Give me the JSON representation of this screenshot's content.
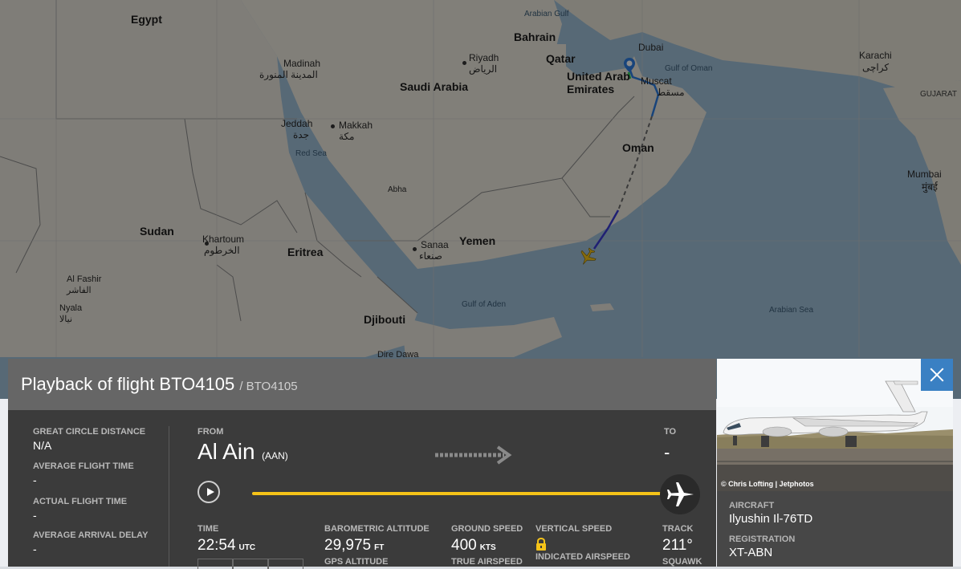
{
  "map": {
    "countries": {
      "egypt": "Egypt",
      "saudi_arabia": "Saudi Arabia",
      "bahrain": "Bahrain",
      "qatar": "Qatar",
      "uae": "United Arab Emirates",
      "oman": "Oman",
      "yemen": "Yemen",
      "sudan": "Sudan",
      "eritrea": "Eritrea",
      "djibouti": "Djibouti"
    },
    "cities": {
      "madinah": "Madinah",
      "madinah_ar": "المدينة المنورة",
      "riyadh": "Riyadh",
      "riyadh_ar": "الرياض",
      "jeddah": "Jeddah",
      "jeddah_ar": "جدة",
      "makkah": "Makkah",
      "makkah_ar": "مكة",
      "dubai": "Dubai",
      "muscat": "Muscat",
      "muscat_ar": "مسقط",
      "karachi": "Karachi",
      "karachi_ar": "کراچی",
      "gujarat": "GUJARAT",
      "mumbai": "Mumbai",
      "mumbai_hi": "मुंबई",
      "abha": "Abha",
      "sanaa": "Sanaa",
      "sanaa_ar": "صنعاء",
      "khartoum": "Khartoum",
      "khartoum_ar": "الخرطوم",
      "al_fashir": "Al Fashir",
      "al_fashir_ar": "الفاشر",
      "nyala": "Nyala",
      "nyala_ar": "نيالا",
      "dire_dawa": "Dire Dawa"
    },
    "seas": {
      "arabian_gulf": "Arabian Gulf",
      "gulf_of_oman": "Gulf of Oman",
      "red_sea": "Red Sea",
      "gulf_of_aden": "Gulf of Aden",
      "arabian_sea": "Arabian Sea"
    }
  },
  "playback": {
    "title": "Playback of flight BTO4105",
    "subtitle": "/ BTO4105",
    "progress": 1.0
  },
  "stats": {
    "great_circle_distance_label": "GREAT CIRCLE DISTANCE",
    "great_circle_distance_value": "N/A",
    "avg_flight_time_label": "AVERAGE FLIGHT TIME",
    "avg_flight_time_value": "-",
    "actual_flight_time_label": "ACTUAL FLIGHT TIME",
    "actual_flight_time_value": "-",
    "avg_arrival_delay_label": "AVERAGE ARRIVAL DELAY",
    "avg_arrival_delay_value": "-"
  },
  "route": {
    "from_label": "FROM",
    "from_city": "Al Ain",
    "from_code": "(AAN)",
    "to_label": "TO",
    "to_city": "-"
  },
  "telemetry": {
    "time_label": "TIME",
    "time_value": "22:54",
    "time_unit": "UTC",
    "baro_alt_label": "BAROMETRIC ALTITUDE",
    "baro_alt_value": "29,975",
    "baro_alt_unit": "FT",
    "gps_alt_label": "GPS ALTITUDE",
    "ground_speed_label": "GROUND SPEED",
    "ground_speed_value": "400",
    "ground_speed_unit": "KTS",
    "true_airspeed_label": "TRUE AIRSPEED",
    "vertical_speed_label": "VERTICAL SPEED",
    "indicated_airspeed_label": "INDICATED AIRSPEED",
    "track_label": "TRACK",
    "track_value": "211°",
    "squawk_label": "SQUAWK"
  },
  "aircraft": {
    "photo_credit": "© Chris Lofting | Jetphotos",
    "aircraft_label": "AIRCRAFT",
    "aircraft_value": "Ilyushin Il-76TD",
    "registration_label": "REGISTRATION",
    "registration_value": "XT-ABN"
  },
  "colors": {
    "accent_yellow": "#f5c318",
    "close_blue": "#3a80c3",
    "header_grey": "#666666",
    "panel_dark": "#3b3b3b"
  },
  "icons": [
    "play-icon",
    "dashed-arrow-icon",
    "airplane-icon",
    "lock-icon",
    "close-icon",
    "location-pin-icon",
    "aircraft-marker-icon"
  ]
}
